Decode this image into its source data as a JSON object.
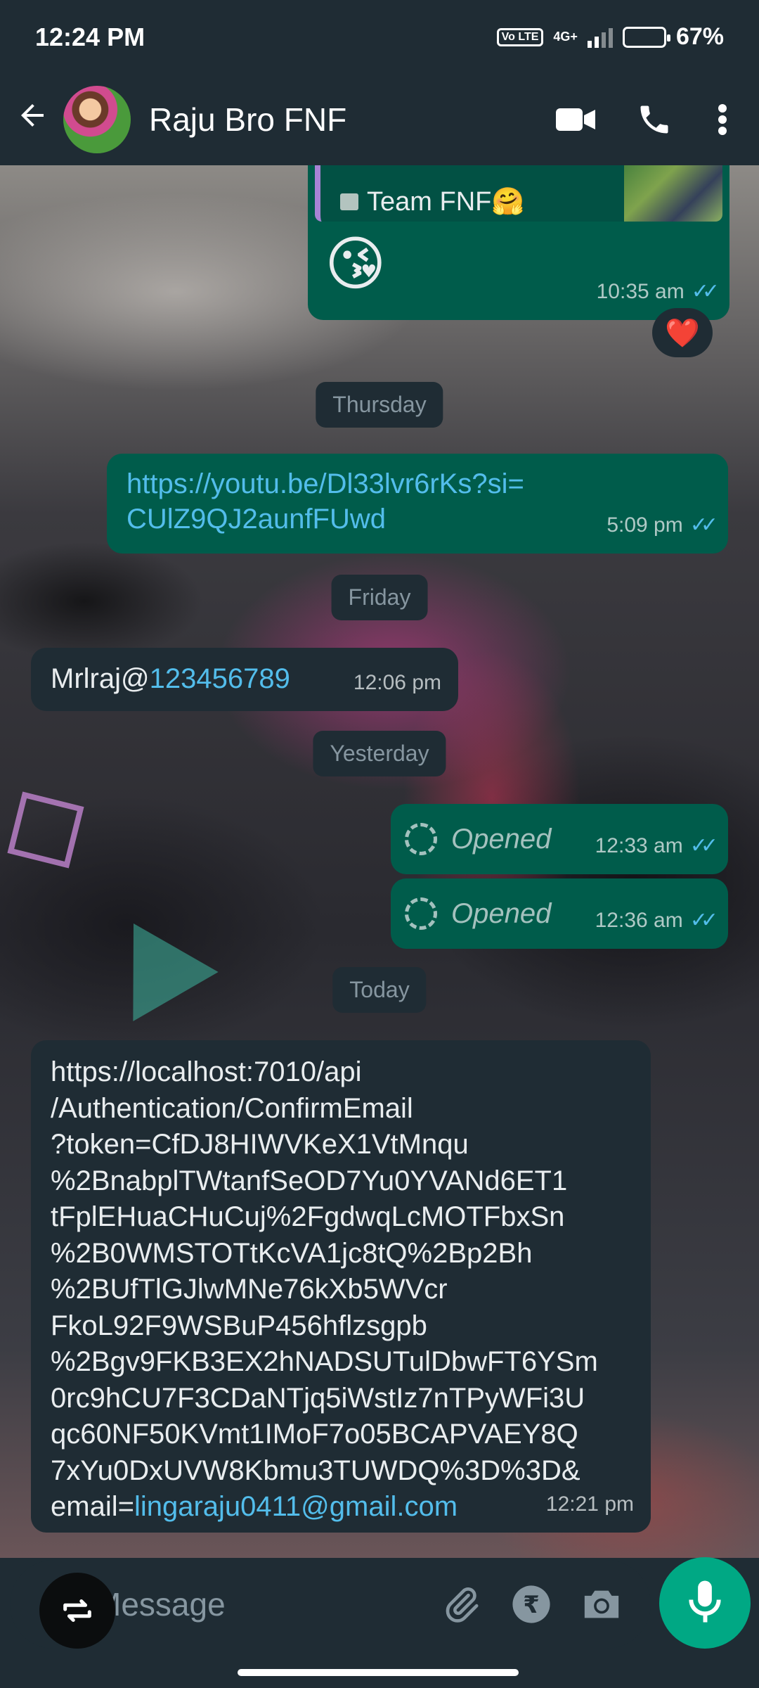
{
  "status_bar": {
    "time": "12:24 PM",
    "volte": "Vo LTE",
    "network": "4G+",
    "battery": "67%"
  },
  "header": {
    "contact_name": "Raju Bro FNF"
  },
  "messages": {
    "quoted_group": "Team FNF🤗",
    "emoji_msg": "😘",
    "emoji_time": "10:35 am",
    "reaction": "❤️",
    "date_thursday": "Thursday",
    "yt_link": "https://youtu.be/Dl33lvr6rKs?si=CUlZ9QJ2aunfFUwd",
    "yt_link_line1": "https://youtu.be/Dl33lvr6rKs?si=",
    "yt_link_line2": "CUlZ9QJ2aunfFUwd",
    "yt_time": "5:09 pm",
    "date_friday": "Friday",
    "cred_prefix": "Mrlraj@",
    "cred_number": "123456789",
    "cred_time": "12:06 pm",
    "date_yesterday": "Yesterday",
    "opened_label": "Opened",
    "opened1_time": "12:33 am",
    "opened2_time": "12:36 am",
    "date_today": "Today",
    "long_link_lines": [
      "https://localhost:7010/api",
      "/Authentication/ConfirmEmail",
      "?token=CfDJ8HIWVKeX1VtMnqu",
      "%2BnabplTWtanfSeOD7Yu0YVANd6ET1",
      "tFplEHuaCHuCuj%2FgdwqLcMOTFbxSn",
      "%2B0WMSTOTtKcVA1jc8tQ%2Bp2Bh",
      "%2BUfTlGJlwMNe76kXb5WVcr",
      "FkoL92F9WSBuP456hflzsgpb",
      "%2Bgv9FKB3EX2hNADSUTulDbwFT6YSm",
      "0rc9hCU7F3CDaNTjq5iWstIz7nTPyWFi3U",
      "qc60NF50KVmt1IMoF7o05BCAPVAEY8Q",
      "7xYu0DxUVW8Kbmu3TUWDQ%3D%3D&"
    ],
    "email_prefix": "email=",
    "email": "lingaraju0411@gmail.com",
    "long_time": "12:21 pm"
  },
  "input": {
    "placeholder": "Message"
  },
  "icons": [
    "back-arrow-icon",
    "video-call-icon",
    "voice-call-icon",
    "more-options-icon",
    "attach-icon",
    "rupee-payment-icon",
    "camera-icon",
    "mic-icon",
    "repeat-icon"
  ],
  "colors": {
    "outgoing": "#005c4b",
    "incoming": "#1f2c34",
    "accent": "#00a884",
    "link": "#53bdeb"
  }
}
